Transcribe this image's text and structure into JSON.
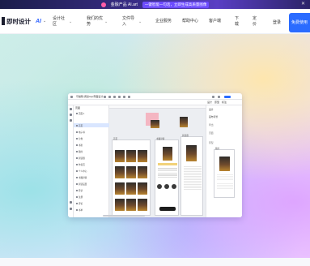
{
  "banner": {
    "product": "金融产品 AI.art",
    "headline": "一键智能一句话，立即生成高质量图像",
    "close_icon": "close-icon"
  },
  "nav": {
    "brand": "即时设计",
    "brand_ai": "AI",
    "items": [
      {
        "label": "设计社区",
        "has_dropdown": true
      },
      {
        "label": "我们的优势",
        "has_dropdown": true
      },
      {
        "label": "文件导入",
        "has_dropdown": true
      },
      {
        "label": "企业服务",
        "has_dropdown": false
      },
      {
        "label": "帮助中心",
        "has_dropdown": false
      },
      {
        "label": "客户端",
        "has_dropdown": false
      },
      {
        "label": "下载",
        "has_dropdown": false
      },
      {
        "label": "定价",
        "has_dropdown": false
      }
    ],
    "login": "登录",
    "try_free": "免费使用"
  },
  "app": {
    "file_name": "可编辑-阅读App界面设计",
    "tabs": [
      "设计",
      "原型",
      "标注"
    ],
    "layers_header": "页面",
    "page_item": "页面 1",
    "layers": [
      "首页",
      "电子书",
      "分类",
      "书架",
      "我的",
      "阅读器",
      "作者页",
      "个人中心",
      "书籍详情",
      "阅读设置",
      "登录",
      "注册",
      "评论",
      "书单",
      "搜索"
    ],
    "props_title": "设计",
    "props_items": [
      "画布背景",
      "导出",
      "页面",
      "原型"
    ],
    "screen_titles": [
      "首页",
      "书籍详情",
      "阅读器",
      "我的"
    ]
  },
  "colors": {
    "accent": "#2a6bff",
    "banner_bg": "#3a2d88",
    "brand_text": "#1b1d2e"
  }
}
